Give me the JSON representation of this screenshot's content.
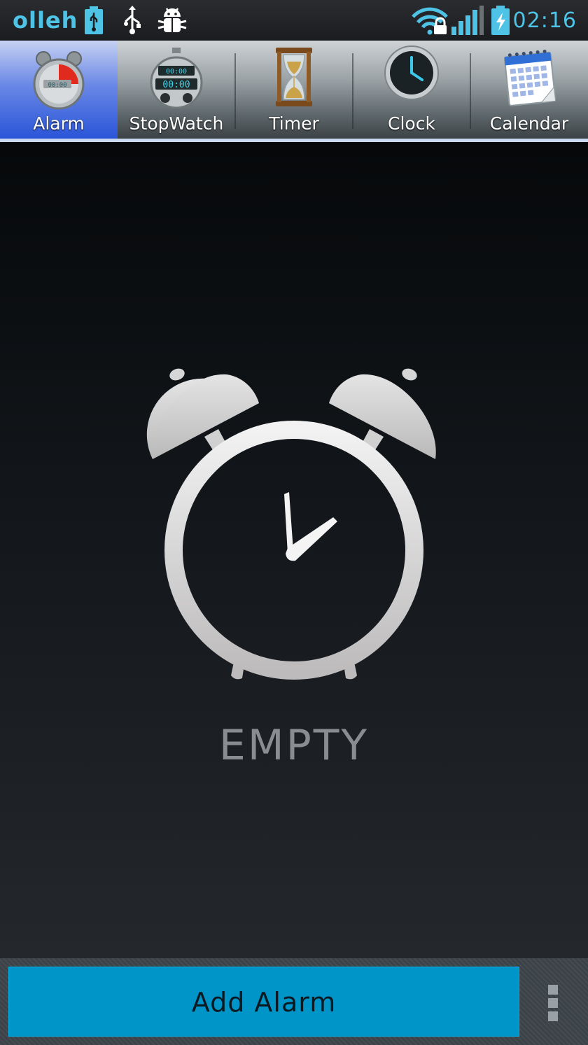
{
  "status_bar": {
    "carrier": "olleh",
    "time": "02:16",
    "icons": [
      "usb-battery-icon",
      "usb-icon",
      "android-debug-icon",
      "wifi-locked-icon",
      "signal-icon",
      "battery-charging-icon"
    ]
  },
  "tabs": [
    {
      "label": "Alarm",
      "icon": "alarm-clock-icon",
      "active": true
    },
    {
      "label": "StopWatch",
      "icon": "stopwatch-icon",
      "active": false
    },
    {
      "label": "Timer",
      "icon": "hourglass-icon",
      "active": false
    },
    {
      "label": "Clock",
      "icon": "clock-icon",
      "active": false
    },
    {
      "label": "Calendar",
      "icon": "calendar-icon",
      "active": false
    }
  ],
  "main": {
    "empty_text": "EMPTY"
  },
  "bottom": {
    "add_alarm_label": "Add Alarm"
  },
  "colors": {
    "accent": "#4ec3e6",
    "active_tab": "#2a55d8",
    "button": "#0095c8"
  }
}
